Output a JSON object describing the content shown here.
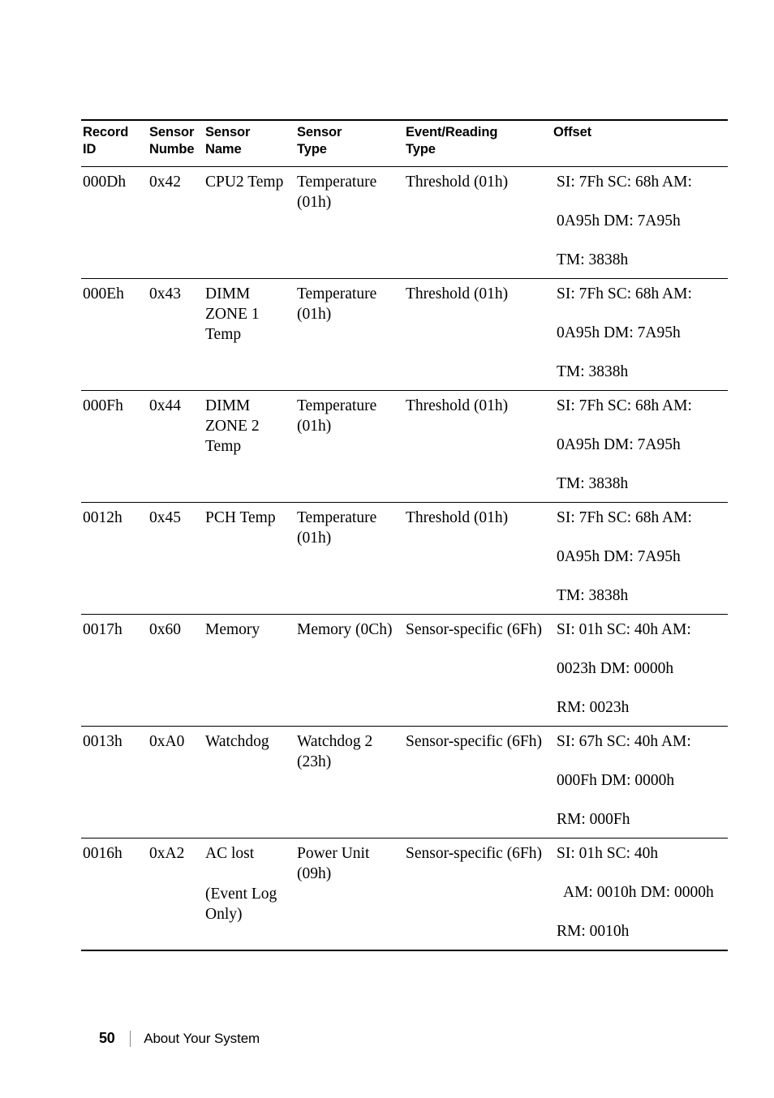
{
  "table": {
    "headers": [
      "Record\nID",
      "Sensor\nNumbe",
      "Sensor\nName",
      "Sensor\nType",
      "Event/Reading\nType",
      "Offset"
    ],
    "rows": [
      {
        "record_id": "000Dh",
        "sensor_number": "0x42",
        "sensor_name": "CPU2 Temp",
        "sensor_type": "Temperature\n(01h)",
        "event_reading_type": "Threshold (01h)",
        "offset_lines": [
          "SI: 7Fh SC: 68h AM:",
          "0A95h DM: 7A95h",
          "TM: 3838h"
        ]
      },
      {
        "record_id": "000Eh",
        "sensor_number": "0x43",
        "sensor_name": "DIMM\nZONE 1\nTemp",
        "sensor_type": "Temperature\n(01h)",
        "event_reading_type": "Threshold (01h)",
        "offset_lines": [
          "SI: 7Fh SC: 68h AM:",
          "0A95h DM: 7A95h",
          "TM: 3838h"
        ]
      },
      {
        "record_id": "000Fh",
        "sensor_number": "0x44",
        "sensor_name": "DIMM\nZONE 2\nTemp",
        "sensor_type": "Temperature\n(01h)",
        "event_reading_type": "Threshold (01h)",
        "offset_lines": [
          "SI: 7Fh SC: 68h AM:",
          "0A95h DM: 7A95h",
          "TM: 3838h"
        ]
      },
      {
        "record_id": "0012h",
        "sensor_number": "0x45",
        "sensor_name": "PCH Temp",
        "sensor_type": "Temperature\n(01h)",
        "event_reading_type": "Threshold (01h)",
        "offset_lines": [
          "SI: 7Fh SC: 68h AM:",
          "0A95h DM: 7A95h",
          "TM: 3838h"
        ]
      },
      {
        "record_id": "0017h",
        "sensor_number": "0x60",
        "sensor_name": "Memory",
        "sensor_type": "Memory (0Ch)",
        "event_reading_type": "Sensor-specific (6Fh)",
        "offset_lines": [
          "SI: 01h SC: 40h AM:",
          "0023h DM: 0000h",
          "RM: 0023h"
        ]
      },
      {
        "record_id": "0013h",
        "sensor_number": "0xA0",
        "sensor_name": "Watchdog",
        "sensor_type": "Watchdog 2\n(23h)",
        "event_reading_type": "Sensor-specific (6Fh)",
        "offset_lines": [
          "SI: 67h SC: 40h AM:",
          "000Fh DM: 0000h",
          "RM: 000Fh"
        ]
      },
      {
        "record_id": "0016h",
        "sensor_number": "0xA2",
        "sensor_name": "AC lost\n\n(Event Log\nOnly)",
        "sensor_type": "Power Unit\n(09h)",
        "event_reading_type": "Sensor-specific (6Fh)",
        "offset_lines": [
          "SI: 01h SC: 40h",
          "AM: 0010h DM: 0000h",
          "RM: 0010h"
        ],
        "offset_indent": [
          false,
          true,
          false
        ]
      }
    ]
  },
  "footer": {
    "page_number": "50",
    "section_title": "About Your System"
  }
}
